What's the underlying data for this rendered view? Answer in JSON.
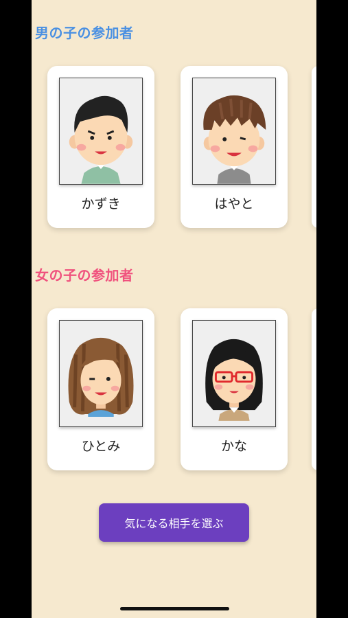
{
  "sections": {
    "boys_title": "男の子の参加者",
    "girls_title": "女の子の参加者"
  },
  "boys": [
    {
      "name": "かずき",
      "avatar_icon": "boy-short-black-hair-icon"
    },
    {
      "name": "はやと",
      "avatar_icon": "boy-brown-hair-icon"
    }
  ],
  "girls": [
    {
      "name": "ひとみ",
      "avatar_icon": "girl-wavy-brown-hair-icon"
    },
    {
      "name": "かな",
      "avatar_icon": "girl-glasses-black-hair-icon"
    }
  ],
  "actions": {
    "choose_label": "気になる相手を選ぶ"
  },
  "colors": {
    "background": "#f6e9cf",
    "boys_title": "#4a90e2",
    "girls_title": "#f0527e",
    "button": "#6c3fbf"
  }
}
